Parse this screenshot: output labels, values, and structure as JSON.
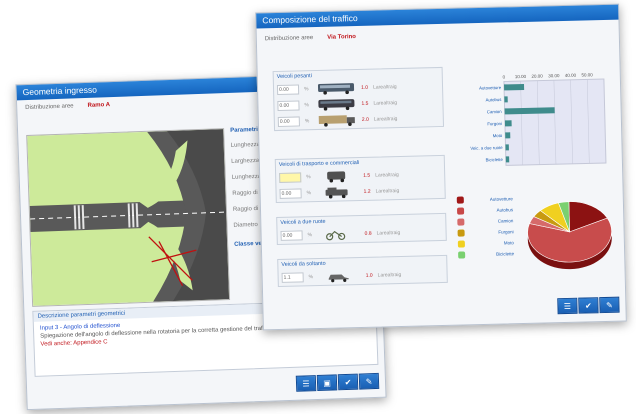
{
  "geometry_window": {
    "title": "Geometria ingresso",
    "subtitle_label": "Distribuzione aree",
    "subtitle_value": "Ramo A",
    "params_title": "Parametri geometrici",
    "params": [
      "Lunghezza",
      "Larghezza",
      "Lunghezza",
      "Raggio di",
      "Raggio di",
      "Diametro"
    ],
    "class_label": "Classe veicolo",
    "desc_title": "Descrizione parametri geometrici",
    "desc_line1": "Input 3 - Angolo di deflessione",
    "desc_line2": "Spiegazione dell'angolo di deflessione nella rotatoria per la corretta gestione del traffico entrante",
    "desc_line3": "Vedi anche:  Appendice C"
  },
  "traffic_window": {
    "title": "Composizione del traffico",
    "subtitle_label": "Distribuzione aree",
    "subtitle_value": "Via Torino",
    "groups": [
      {
        "title": "Veicoli pesanti",
        "rows": [
          {
            "value": "0.00",
            "unit": "%",
            "pct": "1.0",
            "tag": "Larealtraig"
          },
          {
            "value": "0.00",
            "unit": "%",
            "pct": "1.5",
            "tag": "Larealtraig"
          },
          {
            "value": "0.00",
            "unit": "%",
            "pct": "2.0",
            "tag": "Larealtraig"
          }
        ]
      },
      {
        "title": "Veicoli di trasporto e commerciali",
        "rows": [
          {
            "value": "",
            "unit": "%",
            "pct": "1.5",
            "tag": "Larealtraig"
          },
          {
            "value": "0.00",
            "unit": "%",
            "pct": "1.2",
            "tag": "Larealtraig"
          }
        ]
      },
      {
        "title": "Veicoli a due ruote",
        "rows": [
          {
            "value": "0.00",
            "unit": "%",
            "pct": "0.8",
            "tag": "Larealtraig"
          }
        ]
      },
      {
        "title": "Veicoli da soltanto",
        "rows": [
          {
            "value": "1.1",
            "unit": "%",
            "pct": "1.0",
            "tag": "Larealtraig"
          }
        ]
      }
    ],
    "legend": [
      {
        "label": "Autovetture",
        "color": "#a01818"
      },
      {
        "label": "Autobus",
        "color": "#c84848"
      },
      {
        "label": "Camion",
        "color": "#d66a6a"
      },
      {
        "label": "Furgoni",
        "color": "#c89a10"
      },
      {
        "label": "Moto",
        "color": "#f0d020"
      },
      {
        "label": "Biciclette",
        "color": "#7ad070"
      }
    ]
  },
  "chart_data": [
    {
      "type": "bar",
      "orientation": "horizontal",
      "categories": [
        "Autovetture",
        "Autobus",
        "Camion",
        "Furgoni",
        "Moto",
        "Veic. a due ruote",
        "Biciclette"
      ],
      "values": [
        12,
        2,
        30,
        4,
        3,
        2,
        2
      ],
      "xticks": [
        "0",
        "10.00",
        "20.00",
        "30.00",
        "40.00",
        "50.00"
      ],
      "xlim": [
        0,
        60
      ],
      "grid": true,
      "bar_color": "#3f8c8c"
    },
    {
      "type": "pie",
      "labels": [
        "Autovetture",
        "Autobus",
        "Camion",
        "Furgoni",
        "Moto",
        "Biciclette"
      ],
      "values": [
        18,
        62,
        4,
        4,
        8,
        4
      ],
      "value_labels": [
        "",
        "",
        "",
        "",
        "",
        ""
      ],
      "colors": [
        "#8c1212",
        "#c84c4c",
        "#d66a6a",
        "#c89a10",
        "#f0d020",
        "#7ad070"
      ]
    }
  ],
  "buttons": {
    "list": "☰",
    "save": "▣",
    "ok": "✔",
    "close": "✎"
  }
}
